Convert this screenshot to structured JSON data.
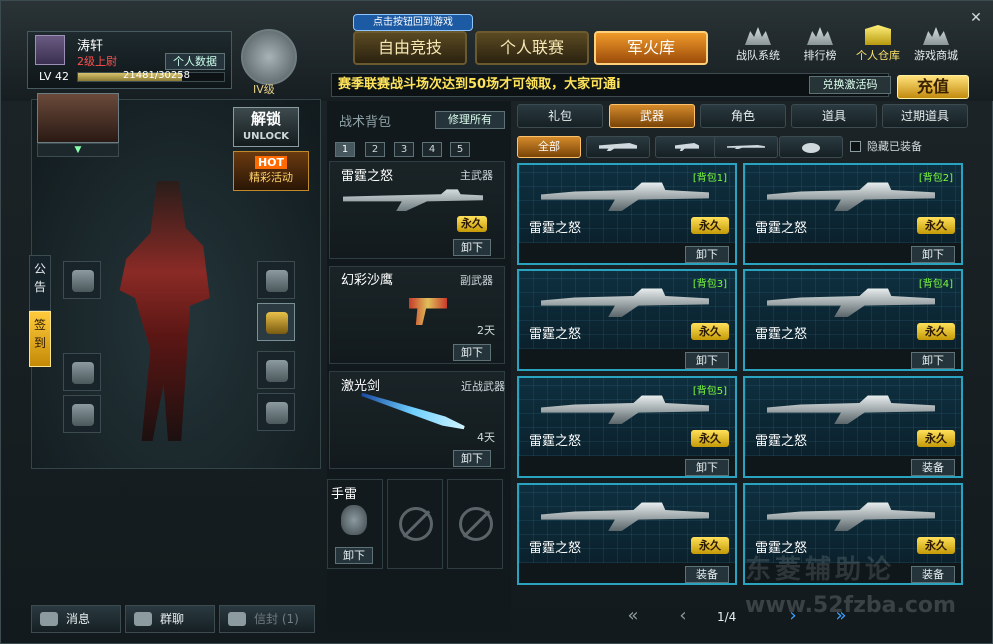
{
  "profile": {
    "name": "涛轩",
    "rank": "2级上尉",
    "info_button": "个人数据",
    "level": "LV 42",
    "xp_text": "21481/30258",
    "xp_fraction": 0.71,
    "emblem_label": "IV级"
  },
  "header": {
    "hint": "点击按钮回到游戏",
    "modes": [
      "自由竞技",
      "个人联赛",
      "军火库"
    ],
    "active_mode": "军火库",
    "icons": [
      {
        "label": "战队系统",
        "icon": "clan-icon"
      },
      {
        "label": "排行榜",
        "icon": "ranking-icon"
      },
      {
        "label": "个人仓库",
        "icon": "warehouse-icon"
      },
      {
        "label": "游戏商城",
        "icon": "shop-icon"
      }
    ],
    "close_glyph": "✕",
    "ticker": "赛季联赛战斗场次达到50场才可领取，大家可通i",
    "redeem_button": "兑换激活码",
    "recharge_button": "充值"
  },
  "left_panel": {
    "unlock_cn": "解锁",
    "unlock_en": "UNLOCK",
    "hot_badge": "HOT",
    "hot_label": "精彩活动",
    "side_tabs": [
      "公告",
      "签到"
    ],
    "avatar_dropdown": "▼"
  },
  "bottom_bar": {
    "message": "消息",
    "group_chat": "群聊",
    "mail": "信封",
    "mail_count": "(1)"
  },
  "backpack": {
    "title": "战术背包",
    "repair_button": "修理所有",
    "tabs": [
      "1",
      "2",
      "3",
      "4",
      "5"
    ],
    "active_tab": "1",
    "items": [
      {
        "name": "雷霆之怒",
        "type": "主武器",
        "duration": "永久",
        "action": "卸下"
      },
      {
        "name": "幻彩沙鹰",
        "type": "副武器",
        "duration": "2天",
        "action": "卸下"
      },
      {
        "name": "激光剑",
        "type": "近战武器",
        "duration": "4天",
        "action": "卸下"
      }
    ],
    "grenade": {
      "name": "手雷",
      "action": "卸下"
    }
  },
  "inventory": {
    "categories": [
      "礼包",
      "武器",
      "角色",
      "道具",
      "过期道具"
    ],
    "active_category": "武器",
    "filters": [
      "全部",
      "rifle-icon",
      "pistol-icon",
      "knife-icon",
      "grenade-icon"
    ],
    "hide_equipped_label": "隐藏已装备",
    "hide_equipped_checked": false,
    "cards": [
      {
        "tag": "[背包1]",
        "name": "雷霆之怒",
        "duration": "永久",
        "action": "卸下"
      },
      {
        "tag": "[背包2]",
        "name": "雷霆之怒",
        "duration": "永久",
        "action": "卸下"
      },
      {
        "tag": "[背包3]",
        "name": "雷霆之怒",
        "duration": "永久",
        "action": "卸下"
      },
      {
        "tag": "[背包4]",
        "name": "雷霆之怒",
        "duration": "永久",
        "action": "卸下"
      },
      {
        "tag": "[背包5]",
        "name": "雷霆之怒",
        "duration": "永久",
        "action": "卸下"
      },
      {
        "tag": "",
        "name": "雷霆之怒",
        "duration": "永久",
        "action": "装备"
      },
      {
        "tag": "",
        "name": "雷霆之怒",
        "duration": "永久",
        "action": "装备"
      },
      {
        "tag": "",
        "name": "雷霆之怒",
        "duration": "永久",
        "action": "装备"
      }
    ],
    "pager": {
      "first": "«",
      "prev": "‹",
      "text": "1/4",
      "next": "›",
      "last": "»"
    }
  },
  "watermark": {
    "text": "www.52fzba.com",
    "cn": "东菱辅助论"
  }
}
